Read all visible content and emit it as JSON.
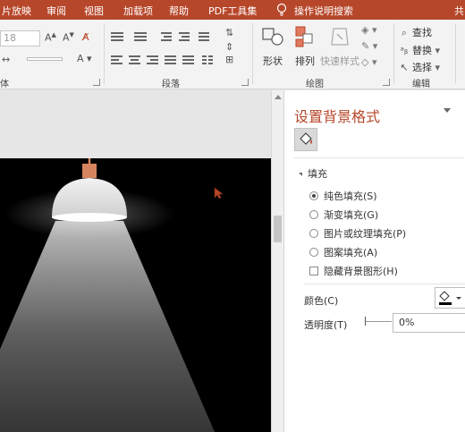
{
  "menubar": {
    "items": [
      "片放映",
      "审阅",
      "视图",
      "加载项",
      "帮助",
      "PDF工具集"
    ],
    "tell_me": "操作说明搜索",
    "share": "共"
  },
  "ribbon": {
    "font_size": "18",
    "groups": {
      "paragraph": "段落",
      "drawing": "绘图",
      "editing": "编辑",
      "font_partial": "体"
    },
    "drawing_buttons": {
      "shapes": "形状",
      "arrange": "排列",
      "quick_styles": "快速样式"
    },
    "editing": {
      "find": "查找",
      "replace": "替换",
      "select": "选择"
    }
  },
  "pane": {
    "title": "设置背景格式",
    "section": "填充",
    "options": [
      {
        "label": "纯色填充(S)",
        "selected": true
      },
      {
        "label": "渐变填充(G)",
        "selected": false
      },
      {
        "label": "图片或纹理填充(P)",
        "selected": false
      },
      {
        "label": "图案填充(A)",
        "selected": false
      }
    ],
    "hide_bg": "隐藏背景图形(H)",
    "color_label": "颜色(C)",
    "transparency_label": "透明度(T)",
    "transparency_value": "0%"
  },
  "colors": {
    "accent": "#b7472a",
    "slide_bg": "#000000",
    "lamp_cord": "#d6835f"
  }
}
